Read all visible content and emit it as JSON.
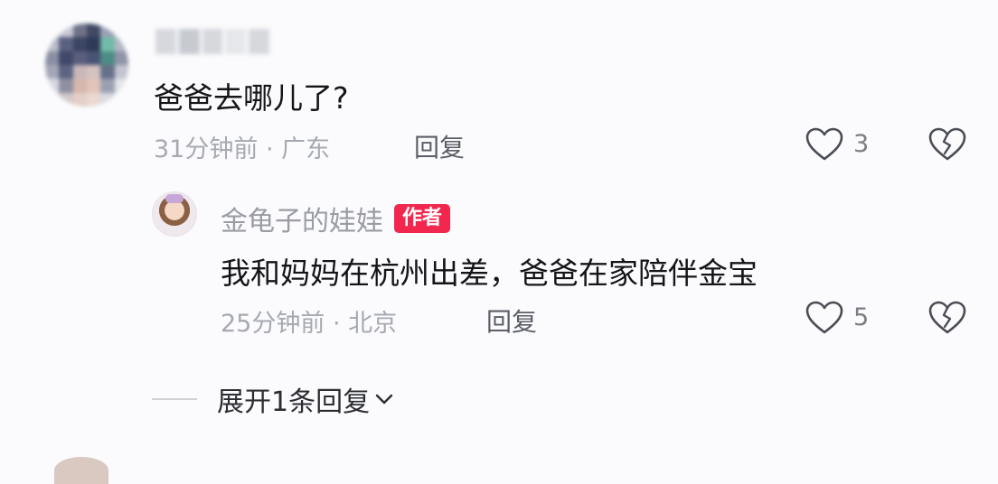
{
  "comment": {
    "text": "爸爸去哪儿了?",
    "meta": "31分钟前 · 广东",
    "reply_label": "回复",
    "like_count": "3"
  },
  "reply": {
    "author": "金龟子的娃娃",
    "badge": "作者",
    "text": "我和妈妈在杭州出差，爸爸在家陪伴金宝",
    "meta": "25分钟前 · 北京",
    "reply_label": "回复",
    "like_count": "5"
  },
  "expand": {
    "label": "展开1条回复"
  },
  "colors": {
    "badge": "#f2274e",
    "meta": "#a6a9b1",
    "text": "#151518"
  },
  "icons": [
    "heart-outline-icon",
    "broken-heart-icon",
    "chevron-down-icon"
  ]
}
